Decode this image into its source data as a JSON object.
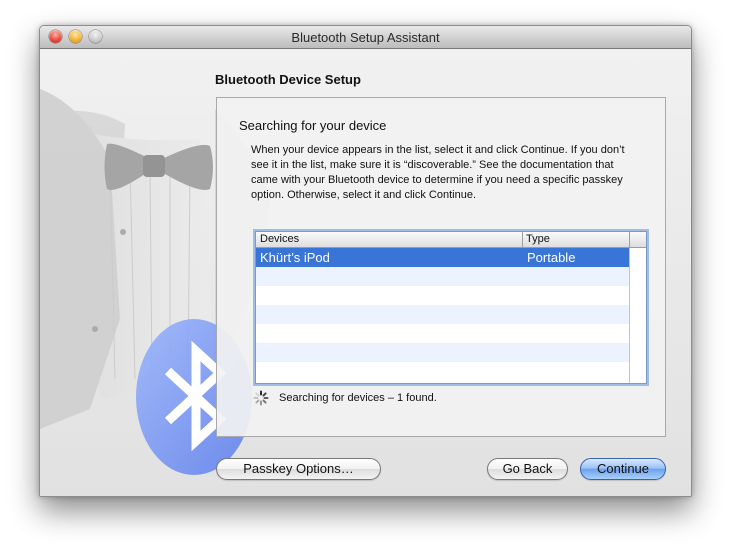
{
  "window": {
    "title": "Bluetooth Setup Assistant"
  },
  "section": {
    "title": "Bluetooth Device Setup"
  },
  "panel": {
    "heading": "Searching for your device",
    "instructions": "When your device appears in the list, select it and click Continue. If you don’t see it in the list, make sure it is “discoverable.” See the documentation that came with your Bluetooth device to determine if you need a specific passkey option. Otherwise, select it and click Continue."
  },
  "table": {
    "columns": [
      "Devices",
      "Type"
    ],
    "rows": [
      {
        "device": "Khürt’s iPod",
        "type": "Portable",
        "selected": true
      }
    ]
  },
  "status": {
    "text": "Searching for devices – 1 found."
  },
  "buttons": {
    "passkey": "Passkey Options…",
    "back": "Go Back",
    "continue": "Continue"
  },
  "colors": {
    "selection": "#3875d7",
    "alt_row": "#edf3fe",
    "default_button": "#6ea2ec",
    "bluetooth_blue": "#6f8ef0"
  }
}
